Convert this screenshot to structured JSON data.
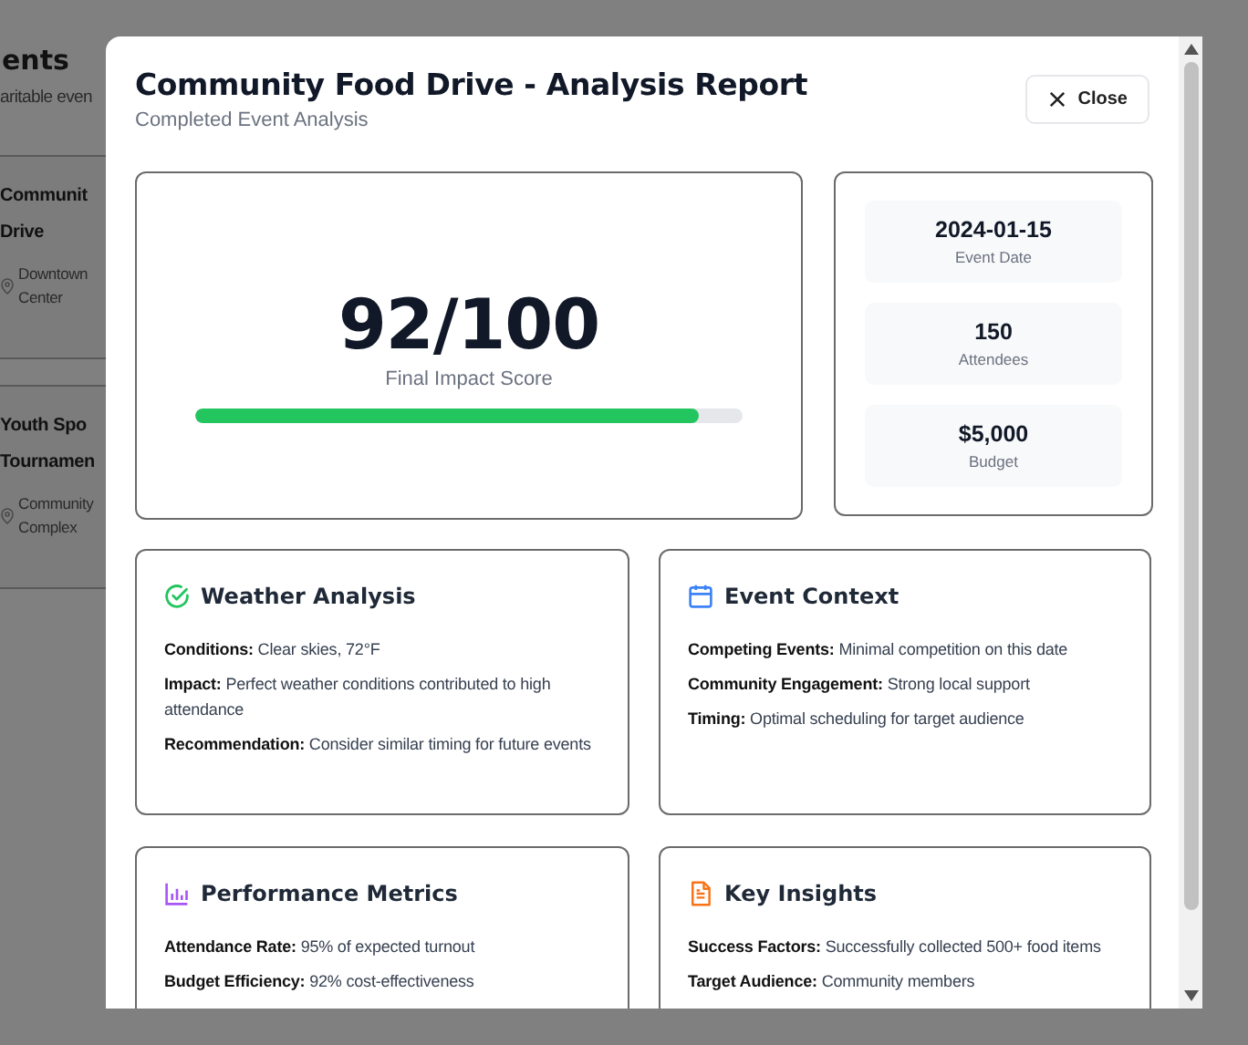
{
  "background": {
    "heading": "ents",
    "subtitle": "aritable even",
    "events": [
      {
        "title_lines": [
          "Communit",
          "Drive"
        ],
        "location_lines": [
          "Downtown",
          "Center"
        ]
      },
      {
        "title_lines": [
          "Youth Spo",
          "Tournamen"
        ],
        "location_lines": [
          "Community",
          "Complex"
        ]
      }
    ]
  },
  "modal": {
    "title": "Community Food Drive - Analysis Report",
    "subtitle": "Completed Event Analysis",
    "close_button": "Close",
    "score": {
      "value": "92/100",
      "label": "Final Impact Score",
      "level": 0.92
    },
    "stats": [
      {
        "value": "2024-01-15",
        "label": "Event Date"
      },
      {
        "value": "150",
        "label": "Attendees"
      },
      {
        "value": "$5,000",
        "label": "Budget"
      }
    ],
    "sections": [
      {
        "kind": "check",
        "title": "Weather Analysis",
        "color": "#22c55e",
        "lines": [
          "**Conditions:** Clear skies, 72°F",
          "**Impact:** Perfect weather conditions contributed to high attendance",
          "**Recommendation:** Consider similar timing for future events"
        ]
      },
      {
        "kind": "calendar",
        "title": "Event Context",
        "color": "#3b82f6",
        "lines": [
          "**Competing Events:** Minimal competition on this date",
          "**Community Engagement:** Strong local support",
          "**Timing:** Optimal scheduling for target audience"
        ]
      },
      {
        "kind": "chart",
        "title": "Performance Metrics",
        "color": "#a855f7",
        "lines": [
          "**Attendance Rate:** 95% of expected turnout",
          "**Budget Efficiency:** 92% cost-effectiveness"
        ]
      },
      {
        "kind": "document",
        "title": "Key Insights",
        "color": "#f97316",
        "lines": [
          "**Success Factors:** Successfully collected 500+ food items",
          "**Target Audience:** Community members"
        ]
      }
    ]
  }
}
